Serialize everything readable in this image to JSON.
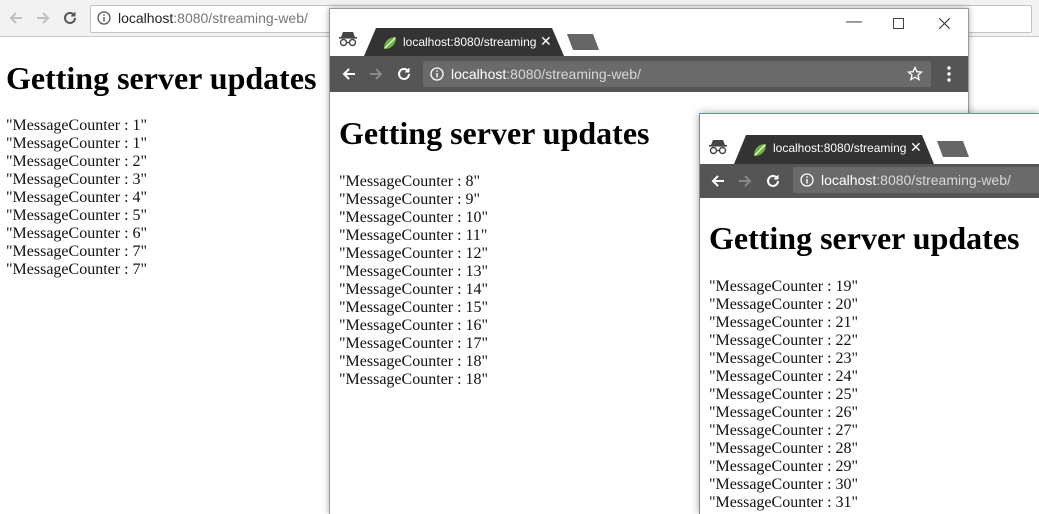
{
  "windows": [
    {
      "url_host": "localhost",
      "url_rest": ":8080/streaming-web/",
      "heading": "Getting server updates",
      "messages": [
        "\"MessageCounter : 1\"",
        "\"MessageCounter : 1\"",
        "\"MessageCounter : 2\"",
        "\"MessageCounter : 3\"",
        "\"MessageCounter : 4\"",
        "\"MessageCounter : 5\"",
        "\"MessageCounter : 6\"",
        "\"MessageCounter : 7\"",
        "\"MessageCounter : 7\""
      ]
    },
    {
      "tab_title": "localhost:8080/streaming",
      "url_host": "localhost",
      "url_rest": ":8080/streaming-web/",
      "heading": "Getting server updates",
      "messages": [
        "\"MessageCounter : 8\"",
        "\"MessageCounter : 9\"",
        "\"MessageCounter : 10\"",
        "\"MessageCounter : 11\"",
        "\"MessageCounter : 12\"",
        "\"MessageCounter : 13\"",
        "\"MessageCounter : 14\"",
        "\"MessageCounter : 15\"",
        "\"MessageCounter : 16\"",
        "\"MessageCounter : 17\"",
        "\"MessageCounter : 18\"",
        "\"MessageCounter : 18\""
      ]
    },
    {
      "tab_title": "localhost:8080/streaming",
      "url_host": "localhost",
      "url_rest": ":8080/streaming-web/",
      "heading": "Getting server updates",
      "messages": [
        "\"MessageCounter : 19\"",
        "\"MessageCounter : 20\"",
        "\"MessageCounter : 21\"",
        "\"MessageCounter : 22\"",
        "\"MessageCounter : 23\"",
        "\"MessageCounter : 24\"",
        "\"MessageCounter : 25\"",
        "\"MessageCounter : 26\"",
        "\"MessageCounter : 27\"",
        "\"MessageCounter : 28\"",
        "\"MessageCounter : 29\"",
        "\"MessageCounter : 30\"",
        "\"MessageCounter : 31\""
      ]
    }
  ],
  "icons": {
    "back": "back-arrow-icon",
    "forward": "forward-arrow-icon",
    "reload": "reload-icon",
    "info": "info-icon",
    "incognito": "incognito-icon",
    "favicon": "spring-leaf-icon",
    "bookmark": "star-icon",
    "menu": "kebab-menu-icon"
  },
  "colors": {
    "dark_toolbar": "#555555",
    "dark_tab": "#333333",
    "favicon_green": "#6db33f"
  }
}
